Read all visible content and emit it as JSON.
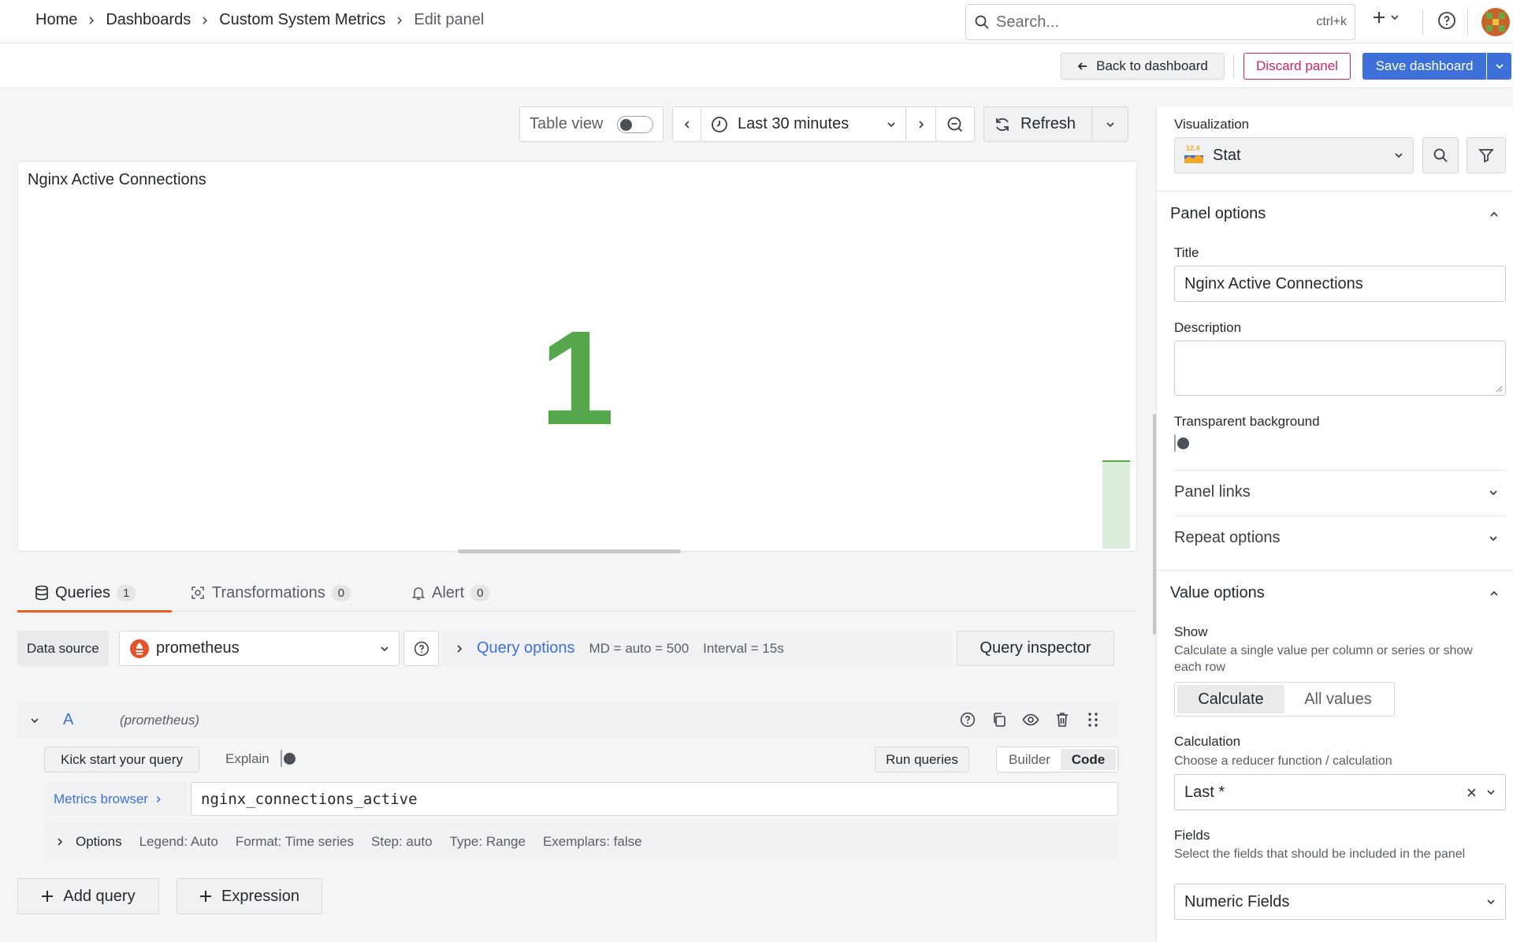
{
  "breadcrumb": [
    "Home",
    "Dashboards",
    "Custom System Metrics",
    "Edit panel"
  ],
  "search": {
    "placeholder": "Search...",
    "shortcut": "ctrl+k"
  },
  "actions": {
    "back": "Back to dashboard",
    "discard": "Discard panel",
    "save": "Save dashboard"
  },
  "toolbar": {
    "table_view": "Table view",
    "time_range": "Last 30 minutes",
    "refresh": "Refresh"
  },
  "panel": {
    "title": "Nginx Active Connections",
    "value": "1"
  },
  "tabs": [
    {
      "label": "Queries",
      "count": "1"
    },
    {
      "label": "Transformations",
      "count": "0"
    },
    {
      "label": "Alert",
      "count": "0"
    }
  ],
  "datasource": {
    "label": "Data source",
    "value": "prometheus",
    "query_options": "Query options",
    "md": "MD = auto = 500",
    "interval": "Interval = 15s",
    "inspector": "Query inspector"
  },
  "query": {
    "ref": "A",
    "ds": "(prometheus)",
    "kickstart": "Kick start your query",
    "explain": "Explain",
    "run": "Run queries",
    "builder": "Builder",
    "code": "Code",
    "metrics_browser": "Metrics browser",
    "expr": "nginx_connections_active",
    "options_label": "Options",
    "options": [
      "Legend: Auto",
      "Format: Time series",
      "Step: auto",
      "Type: Range",
      "Exemplars: false"
    ]
  },
  "add": {
    "query": "Add query",
    "expression": "Expression"
  },
  "options": {
    "viz_label": "Visualization",
    "viz": "Stat",
    "viz_badge": "12.4",
    "panel_options": "Panel options",
    "title_label": "Title",
    "title_value": "Nginx Active Connections",
    "desc_label": "Description",
    "transparent_label": "Transparent background",
    "panel_links": "Panel links",
    "repeat_options": "Repeat options",
    "value_options": "Value options",
    "show_label": "Show",
    "show_desc": "Calculate a single value per column or series or show each row",
    "show_calculate": "Calculate",
    "show_all": "All values",
    "calc_label": "Calculation",
    "calc_desc": "Choose a reducer function / calculation",
    "calc_value": "Last *",
    "fields_label": "Fields",
    "fields_desc": "Select the fields that should be included in the panel",
    "fields_value": "Numeric Fields"
  },
  "colors": {
    "accent": "#3d71d9",
    "danger": "#d6206c",
    "stat": "#56a64b",
    "tab_active": "#f05a28"
  }
}
